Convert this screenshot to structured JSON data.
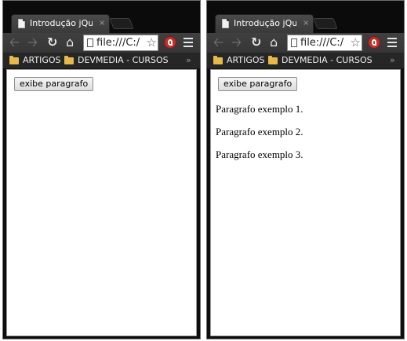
{
  "windows": [
    {
      "tab": {
        "title": "Introdução jQuery",
        "close": "×"
      },
      "address": {
        "text": "file:///C:/"
      },
      "bookmarks": [
        {
          "label": "ARTIGOS"
        },
        {
          "label": "DEVMEDIA - CURSOS"
        }
      ],
      "bookmarks_more": "»",
      "page": {
        "button_label": "exibe paragrafo",
        "paragraphs": []
      }
    },
    {
      "tab": {
        "title": "Introdução jQuery",
        "close": "×"
      },
      "address": {
        "text": "file:///C:/"
      },
      "bookmarks": [
        {
          "label": "ARTIGOS"
        },
        {
          "label": "DEVMEDIA - CURSOS"
        }
      ],
      "bookmarks_more": "»",
      "page": {
        "button_label": "exibe paragrafo",
        "paragraphs": [
          "Paragrafo exemplo 1.",
          "Paragrafo exemplo 2.",
          "Paragrafo exemplo 3."
        ]
      }
    }
  ],
  "icons": {
    "back": "back-arrow-icon",
    "forward": "forward-arrow-icon",
    "reload": "reload-icon",
    "home": "home-icon",
    "star": "star-icon",
    "menu": "menu-icon",
    "folder": "folder-icon",
    "extension": "extension-icon"
  },
  "colors": {
    "chrome_dark": "#0b0b0b",
    "tab": "#4a4a4a",
    "toolbar": "#3b3b3b",
    "bookmarks_bar": "#262626",
    "folder": "#e6b94a",
    "extension": "#c0302a"
  }
}
